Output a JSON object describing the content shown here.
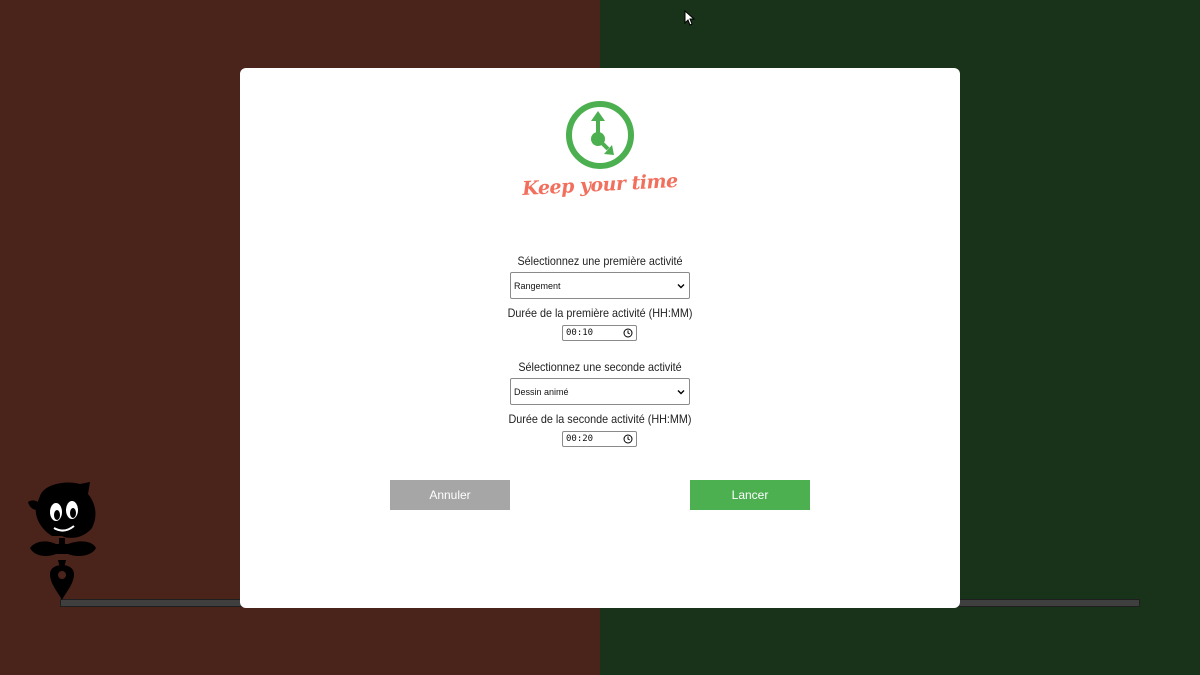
{
  "brand": {
    "name": "Keep your time",
    "accent": "#4caf50",
    "name_color": "#f16f5c"
  },
  "form": {
    "first": {
      "label": "Sélectionnez une première activité",
      "value": "Rangement",
      "duration_label": "Durée de la première activité (HH:MM)",
      "duration": "00:10"
    },
    "second": {
      "label": "Sélectionnez une seconde activité",
      "value": "Dessin animé",
      "duration_label": "Durée de la seconde activité (HH:MM)",
      "duration": "00:20"
    }
  },
  "buttons": {
    "cancel": "Annuler",
    "start": "Lancer"
  },
  "colors": {
    "left_panel": "#4a231b",
    "right_panel": "#183319",
    "cancel_button": "#a6a6a6"
  }
}
